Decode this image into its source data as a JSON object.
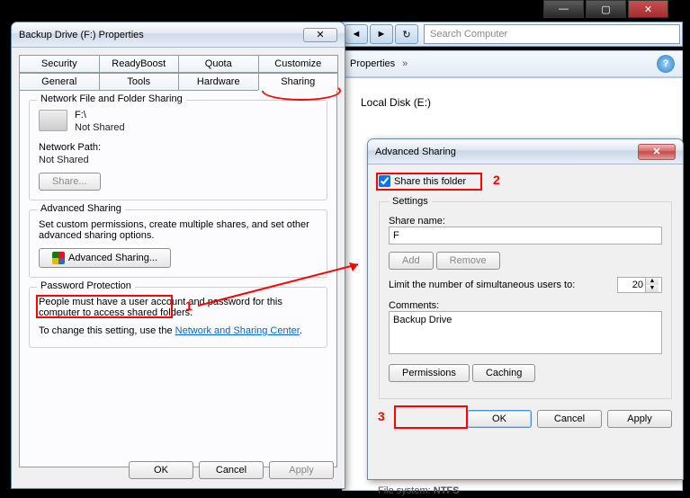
{
  "app_chrome": {
    "min": "—",
    "max": "▢",
    "close": "✕"
  },
  "explorer": {
    "back": "◄",
    "fwd": "►",
    "refresh": "↻",
    "search_placeholder": "Search Computer",
    "properties_label": "Properties",
    "chev": "»",
    "help": "?",
    "disk_label": "Local Disk (E:)",
    "fs_label": "File system:",
    "fs_value": "NTFS"
  },
  "props": {
    "title": "Backup Drive (F:) Properties",
    "close_glyph": "✕",
    "tabs_row1": [
      "Security",
      "ReadyBoost",
      "Quota",
      "Customize"
    ],
    "tabs_row2": [
      "General",
      "Tools",
      "Hardware",
      "Sharing"
    ],
    "nfs": {
      "legend": "Network File and Folder Sharing",
      "drive_path": "F:\\",
      "shared_status": "Not Shared",
      "net_path_label": "Network Path:",
      "net_path_value": "Not Shared",
      "share_btn": "Share..."
    },
    "advsec": {
      "legend": "Advanced Sharing",
      "desc": "Set custom permissions, create multiple shares, and set other advanced sharing options.",
      "btn": "Advanced Sharing..."
    },
    "pp": {
      "legend": "Password Protection",
      "desc": "People must have a user account and password for this computer to access shared folders.",
      "change_prefix": "To change this setting, use the ",
      "link": "Network and Sharing Center",
      "suffix": "."
    },
    "btns": {
      "ok": "OK",
      "cancel": "Cancel",
      "apply": "Apply"
    }
  },
  "adv": {
    "title": "Advanced Sharing",
    "close_glyph": "✕",
    "share_chk": "Share this folder",
    "settings": "Settings",
    "share_name_label": "Share name:",
    "share_name_value": "F",
    "add_btn": "Add",
    "remove_btn": "Remove",
    "limit_label": "Limit the number of simultaneous users to:",
    "limit_value": "20",
    "up": "▲",
    "down": "▼",
    "comments_label": "Comments:",
    "comments_value": "Backup Drive",
    "perm_btn": "Permissions",
    "cache_btn": "Caching",
    "ok": "OK",
    "cancel": "Cancel",
    "apply": "Apply"
  },
  "annotations": {
    "n1": "1",
    "n2": "2",
    "n3": "3"
  }
}
